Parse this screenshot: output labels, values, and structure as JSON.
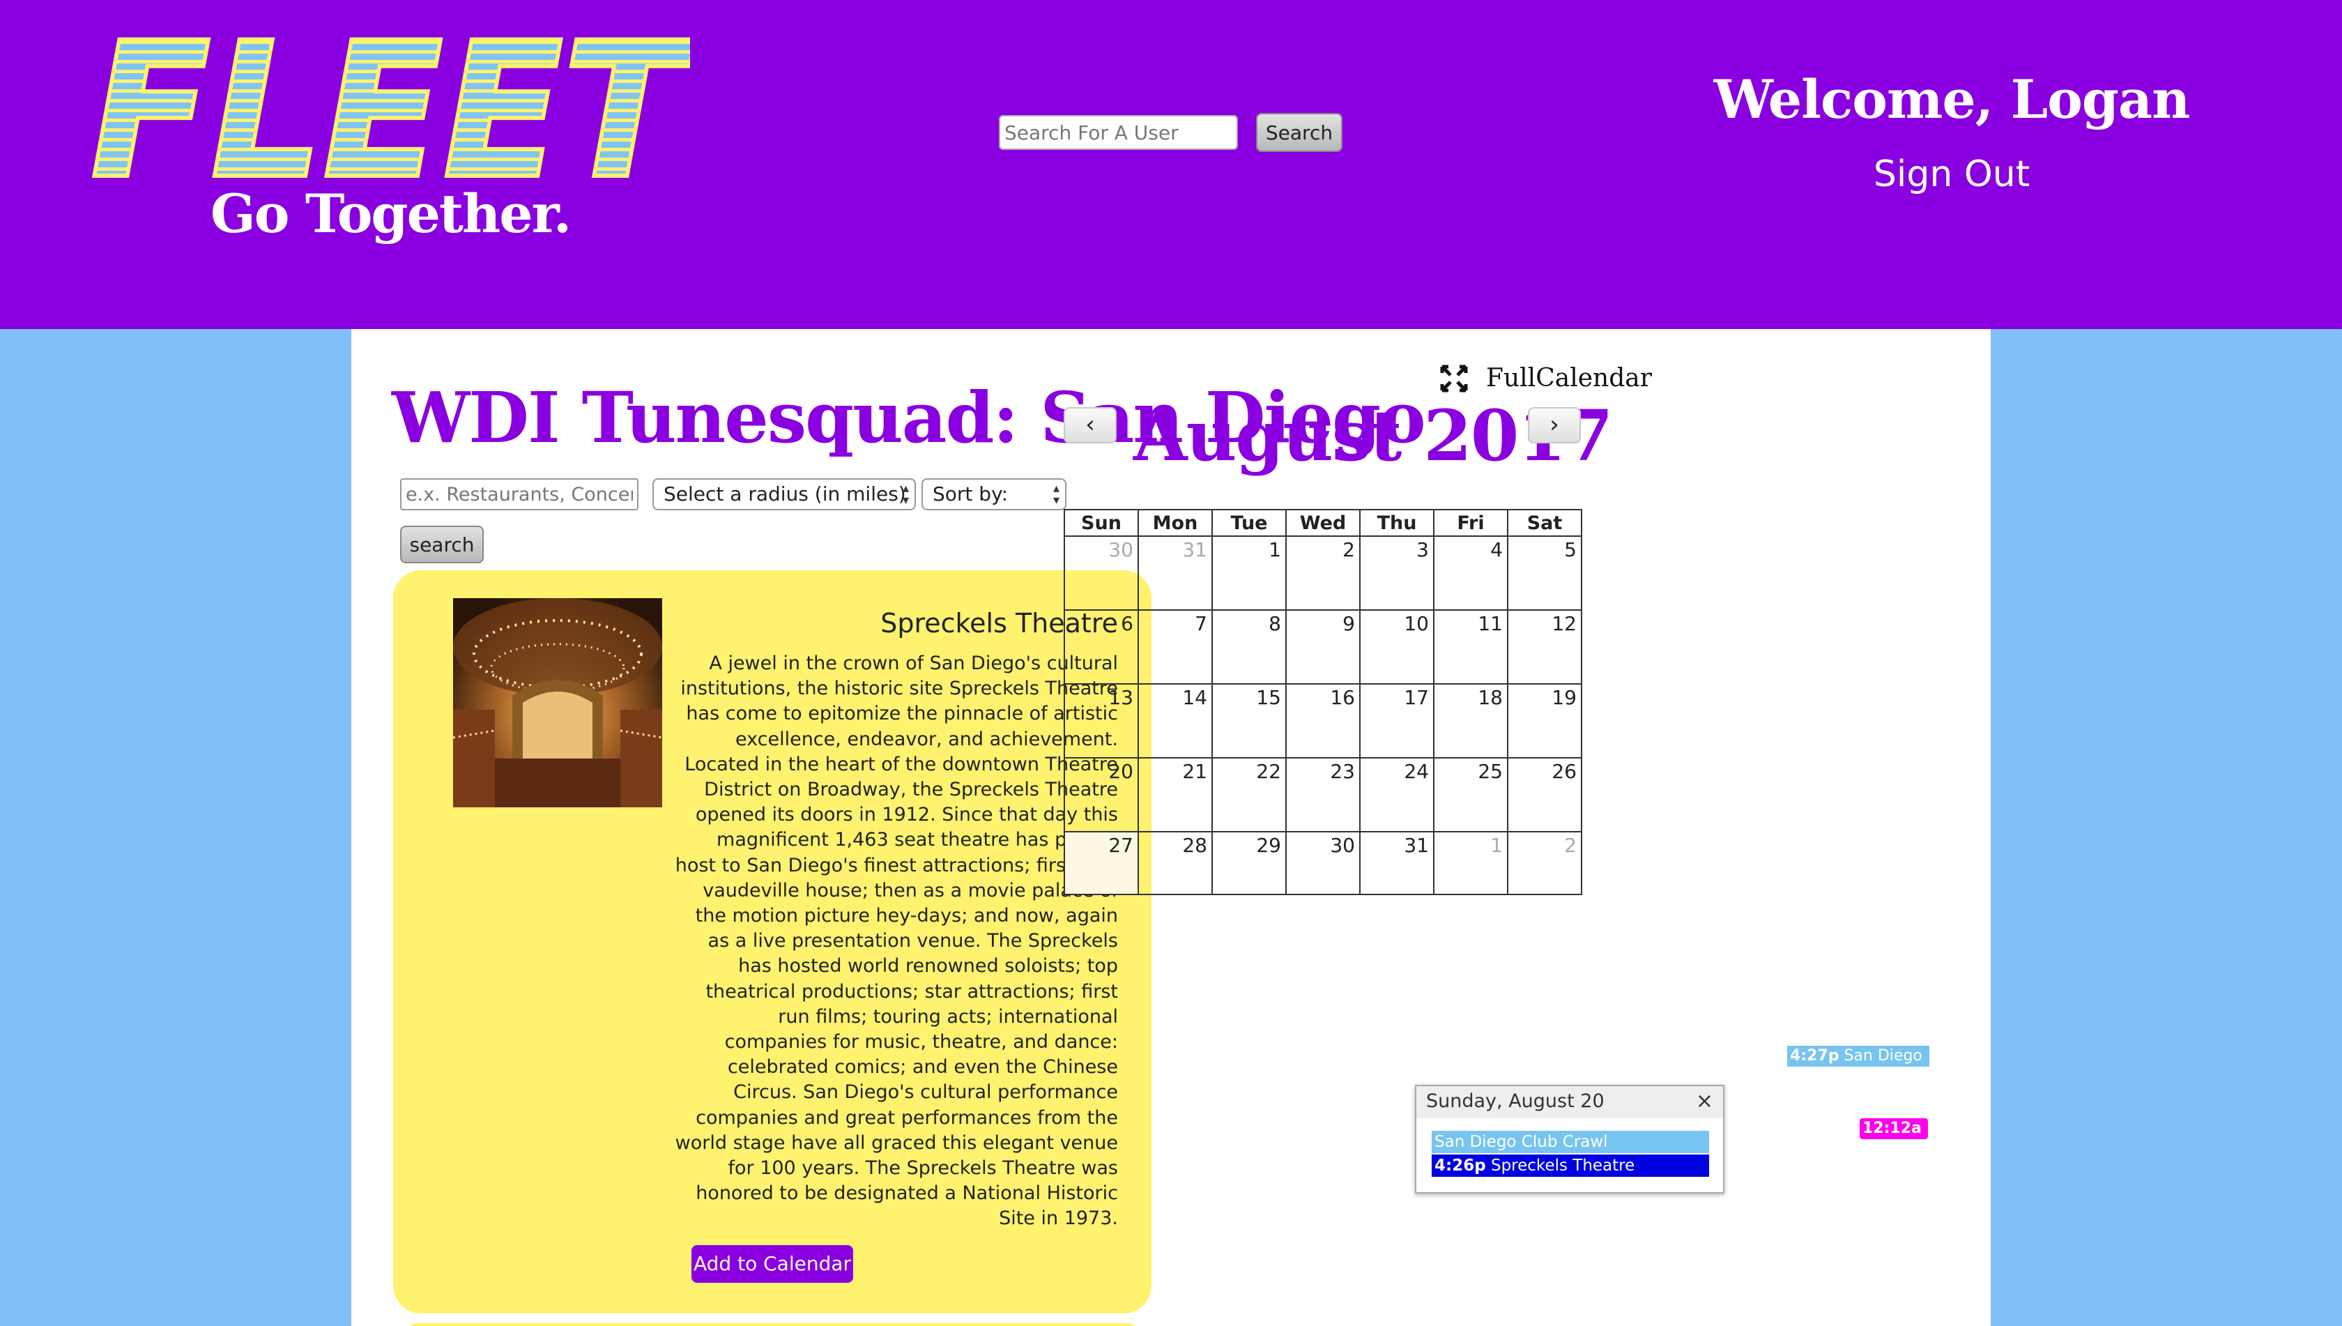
{
  "header": {
    "logo_text": "FLEET",
    "tagline": "Go Together.",
    "user_search_placeholder": "Search For A User",
    "user_search_button": "Search",
    "welcome": "Welcome, Logan",
    "sign_out": "Sign Out"
  },
  "group": {
    "title": "WDI Tunesquad: San Diego"
  },
  "filters": {
    "keyword_placeholder": "e.x. Restaurants, Concerts",
    "radius_label": "Select a radius (in miles)",
    "sort_label": "Sort by:",
    "search_button": "search"
  },
  "event": {
    "name": "Spreckels Theatre",
    "description": "A jewel in the crown of San Diego's cultural institutions, the historic site Spreckels Theatre has come to epitomize the pinnacle of artistic excellence, endeavor, and achievement. Located in the heart of the downtown Theatre District on Broadway, the Spreckels Theatre opened its doors in 1912. Since that day this magnificent 1,463 seat theatre has played host to San Diego's finest attractions; first as a vaudeville house; then as a movie palace of the motion picture hey-days; and now, again as a live presentation venue. The Spreckels has hosted world renowned soloists; top theatrical productions; star attractions; first run films; touring acts; international companies for music, theatre, and dance: celebrated comics; and even the Chinese Circus. San Diego's cultural performance companies and great performances from the world stage have all graced this elegant venue for 100 years. The Spreckels Theatre was honored to be designated a National Historic Site in 1973.",
    "add_button": "Add to Calendar"
  },
  "calendar": {
    "brand": "FullCalendar",
    "month_title": "August 2017",
    "prev": "‹",
    "next": "›",
    "weekdays": [
      "Sun",
      "Mon",
      "Tue",
      "Wed",
      "Thu",
      "Fri",
      "Sat"
    ],
    "weeks": [
      [
        {
          "d": "30",
          "o": true
        },
        {
          "d": "31",
          "o": true
        },
        {
          "d": "1"
        },
        {
          "d": "2"
        },
        {
          "d": "3"
        },
        {
          "d": "4"
        },
        {
          "d": "5"
        }
      ],
      [
        {
          "d": "6"
        },
        {
          "d": "7"
        },
        {
          "d": "8"
        },
        {
          "d": "9"
        },
        {
          "d": "10"
        },
        {
          "d": "11"
        },
        {
          "d": "12"
        }
      ],
      [
        {
          "d": "13"
        },
        {
          "d": "14"
        },
        {
          "d": "15"
        },
        {
          "d": "16"
        },
        {
          "d": "17"
        },
        {
          "d": "18"
        },
        {
          "d": "19"
        }
      ],
      [
        {
          "d": "20"
        },
        {
          "d": "21"
        },
        {
          "d": "22"
        },
        {
          "d": "23"
        },
        {
          "d": "24"
        },
        {
          "d": "25"
        },
        {
          "d": "26"
        }
      ],
      [
        {
          "d": "27",
          "t": true
        },
        {
          "d": "28"
        },
        {
          "d": "29"
        },
        {
          "d": "30"
        },
        {
          "d": "31"
        },
        {
          "d": "1",
          "o": true
        },
        {
          "d": "2",
          "o": true
        }
      ]
    ],
    "events": {
      "sat19": {
        "time": "4:27p",
        "title": "San Diego"
      },
      "sat26": {
        "time": "12:12a",
        "title": ""
      }
    },
    "popover": {
      "title": "Sunday, August 20",
      "close": "×",
      "event1": "San Diego Club Crawl",
      "event2_time": "4:26p",
      "event2_title": "Spreckels Theatre"
    },
    "colors": {
      "event_blue": "#78c4f0",
      "event_magenta": "#ff00ee",
      "event_dark_blue": "#0000e0"
    }
  },
  "theme": {
    "purple": "#8a00e0",
    "card_yellow": "#fff26e",
    "sky_blue": "#80bff8"
  }
}
